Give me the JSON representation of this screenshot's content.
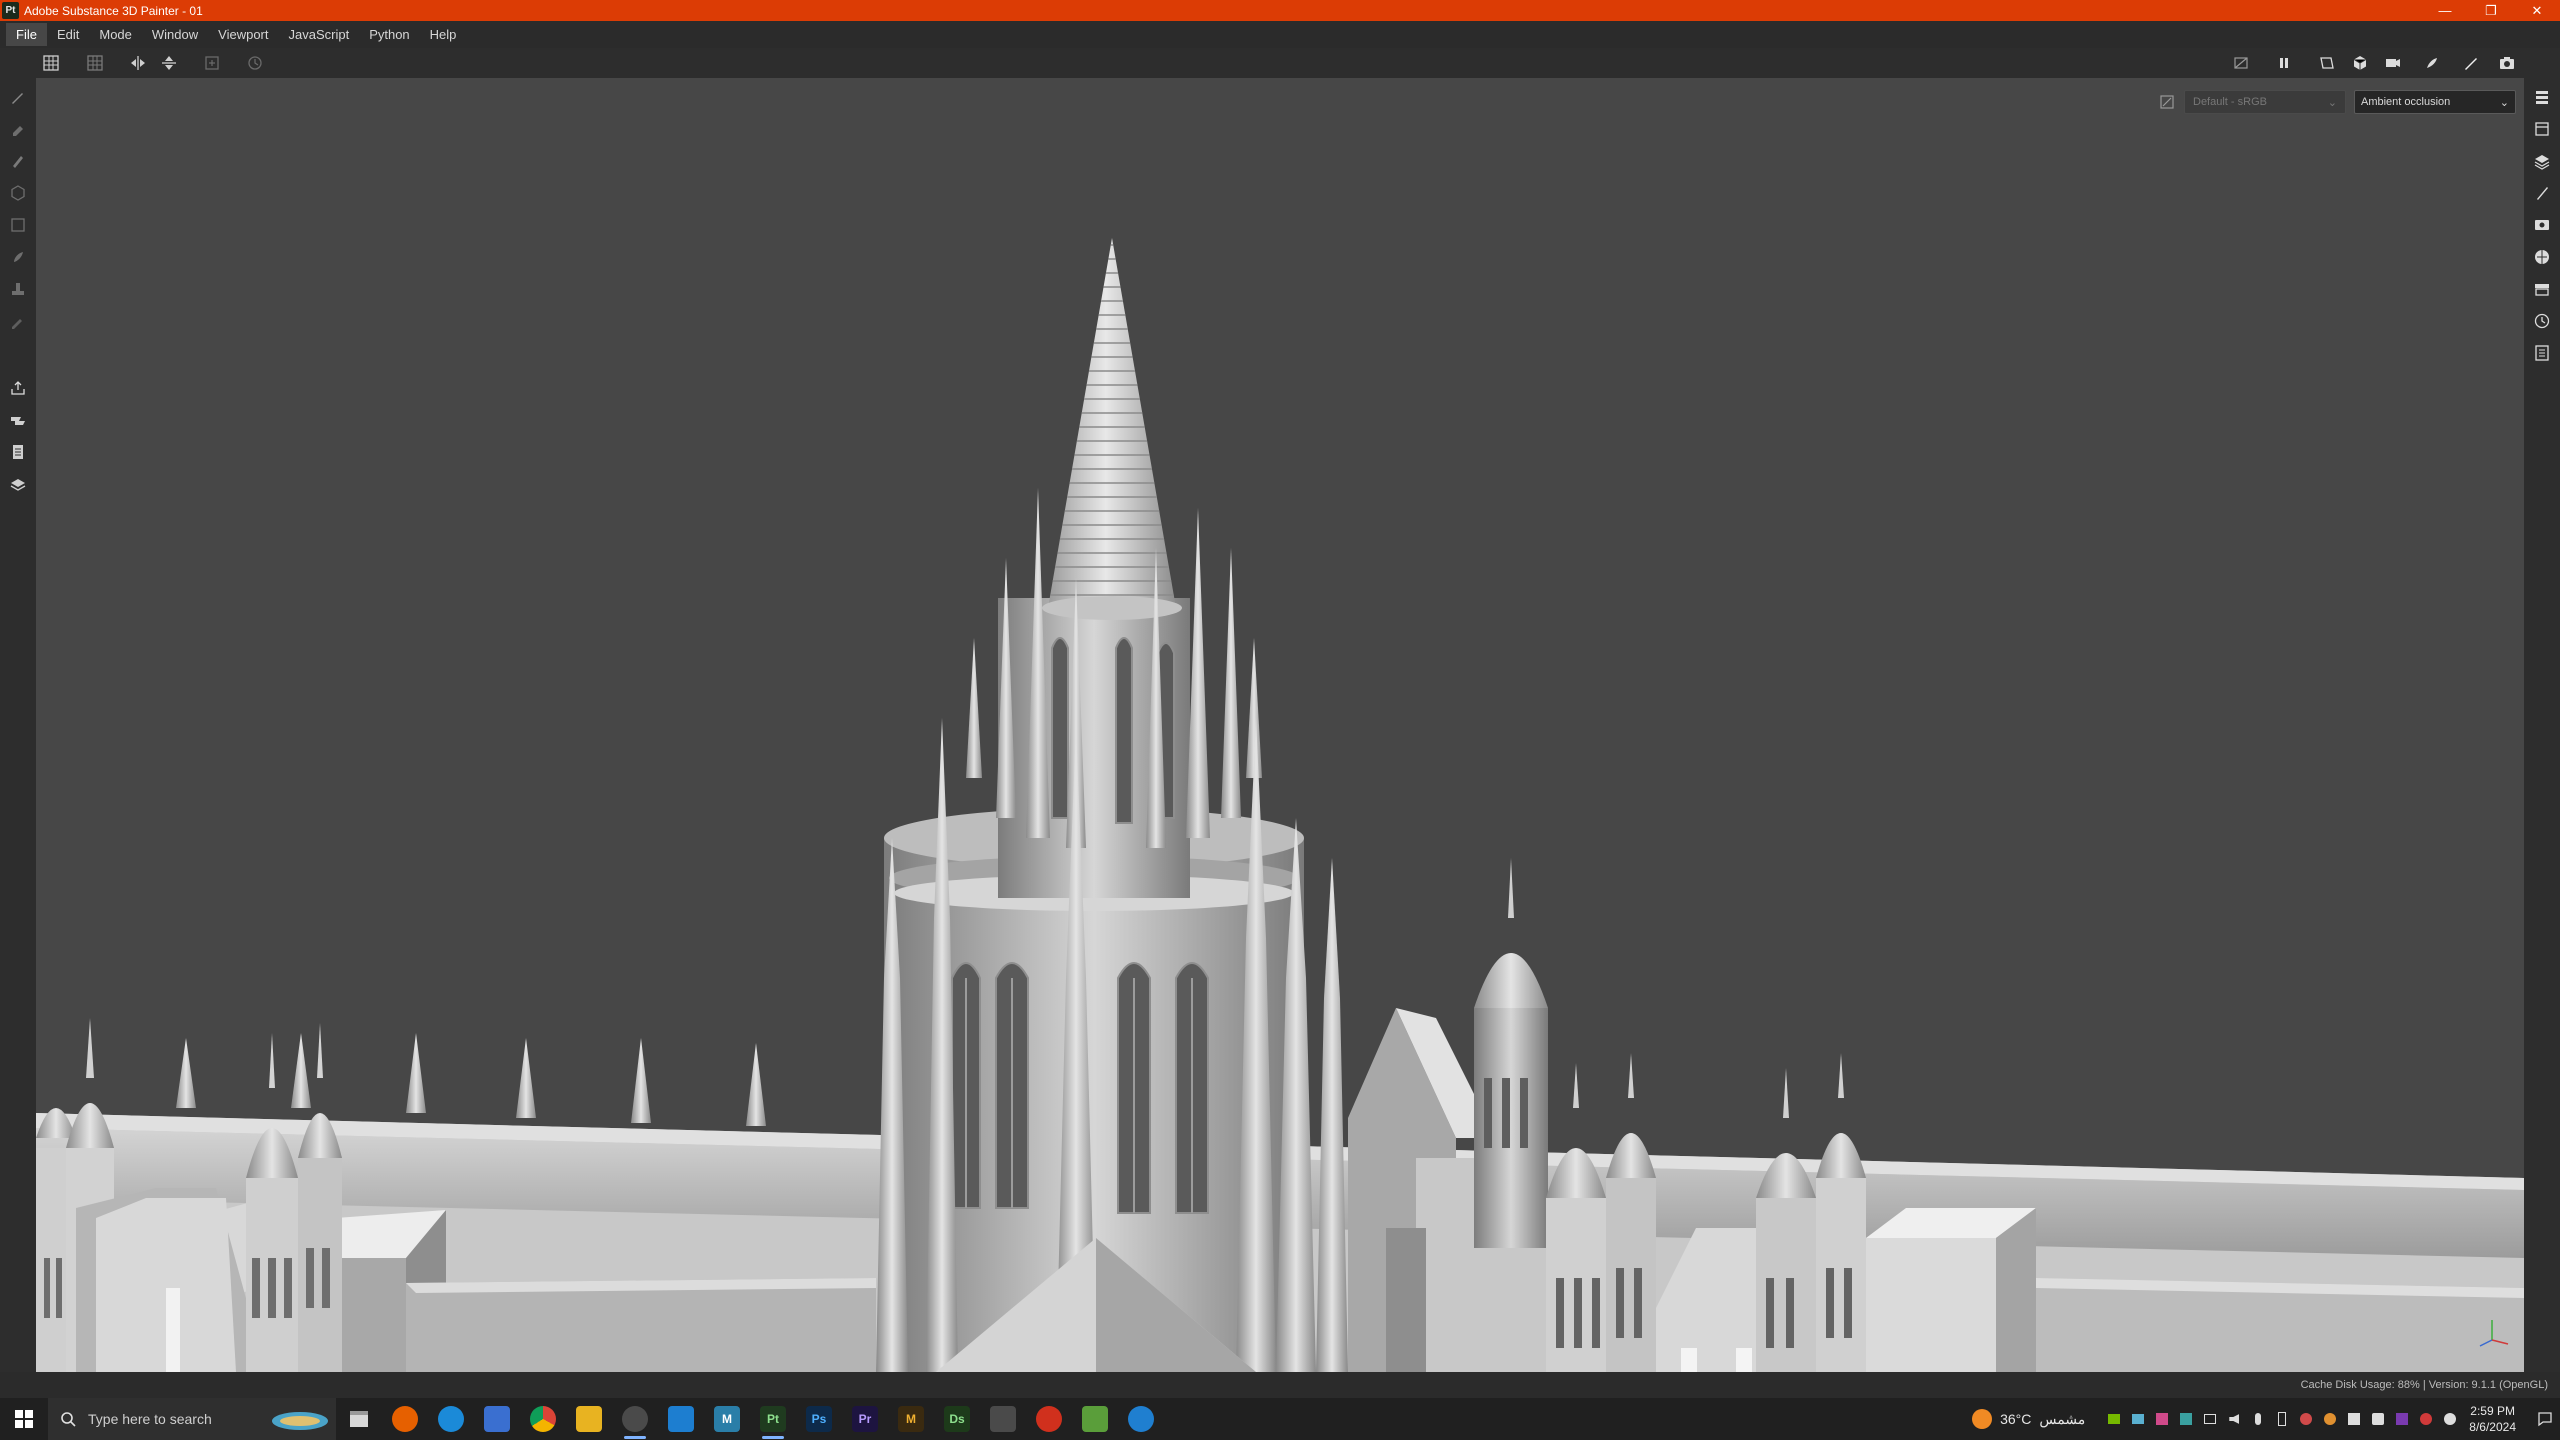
{
  "window": {
    "app_logo": "Pt",
    "title": "Adobe Substance 3D Painter - 01",
    "minimize": "—",
    "restore": "❐",
    "close": "✕"
  },
  "menu": {
    "items": [
      "File",
      "Edit",
      "Mode",
      "Window",
      "Viewport",
      "JavaScript",
      "Python",
      "Help"
    ]
  },
  "viewport": {
    "color_profile": "Default - sRGB",
    "display_mode": "Ambient occlusion"
  },
  "status": {
    "text": "Cache Disk Usage:   88% | Version: 9.1.1 (OpenGL)"
  },
  "taskbar": {
    "search_placeholder": "Type here to search",
    "apps": [
      {
        "name": "task-view",
        "label": "",
        "color": "#2b2b2b"
      },
      {
        "name": "clapper",
        "label": "",
        "color": "#3a3a3a"
      },
      {
        "name": "firefox",
        "label": "",
        "color": "#e66000"
      },
      {
        "name": "edge",
        "label": "",
        "color": "#1b8ad8"
      },
      {
        "name": "store",
        "label": "",
        "color": "#3a6fd0"
      },
      {
        "name": "chrome",
        "label": "",
        "color": "#2e9e4f"
      },
      {
        "name": "file-explorer",
        "label": "",
        "color": "#e8b321"
      },
      {
        "name": "steam-app",
        "label": "",
        "color": "#4a4a4a"
      },
      {
        "name": "app-blue",
        "label": "",
        "color": "#1d7ed0"
      },
      {
        "name": "maya",
        "label": "M",
        "color": "#2a7ea8"
      },
      {
        "name": "substance-painter",
        "label": "Pt",
        "color": "#1f3b1f"
      },
      {
        "name": "photoshop",
        "label": "Ps",
        "color": "#0d2a4a"
      },
      {
        "name": "premiere",
        "label": "Pr",
        "color": "#1d1440"
      },
      {
        "name": "marmoset",
        "label": "M",
        "color": "#3a2a10"
      },
      {
        "name": "substance-designer",
        "label": "Ds",
        "color": "#1d3a1a"
      },
      {
        "name": "photos",
        "label": "",
        "color": "#4a4a4a"
      },
      {
        "name": "app-red",
        "label": "",
        "color": "#d0301d"
      },
      {
        "name": "app-green",
        "label": "",
        "color": "#5a9e3a"
      },
      {
        "name": "app-settings",
        "label": "",
        "color": "#1f7fd0"
      }
    ],
    "weather_temp": "36°C",
    "weather_desc": "مشمس",
    "time": "2:59 PM",
    "date": "8/6/2024"
  },
  "colors": {
    "titlebar": "#dc3c05",
    "viewport_bg": "#474747",
    "panel_bg": "#2d2d2d"
  }
}
